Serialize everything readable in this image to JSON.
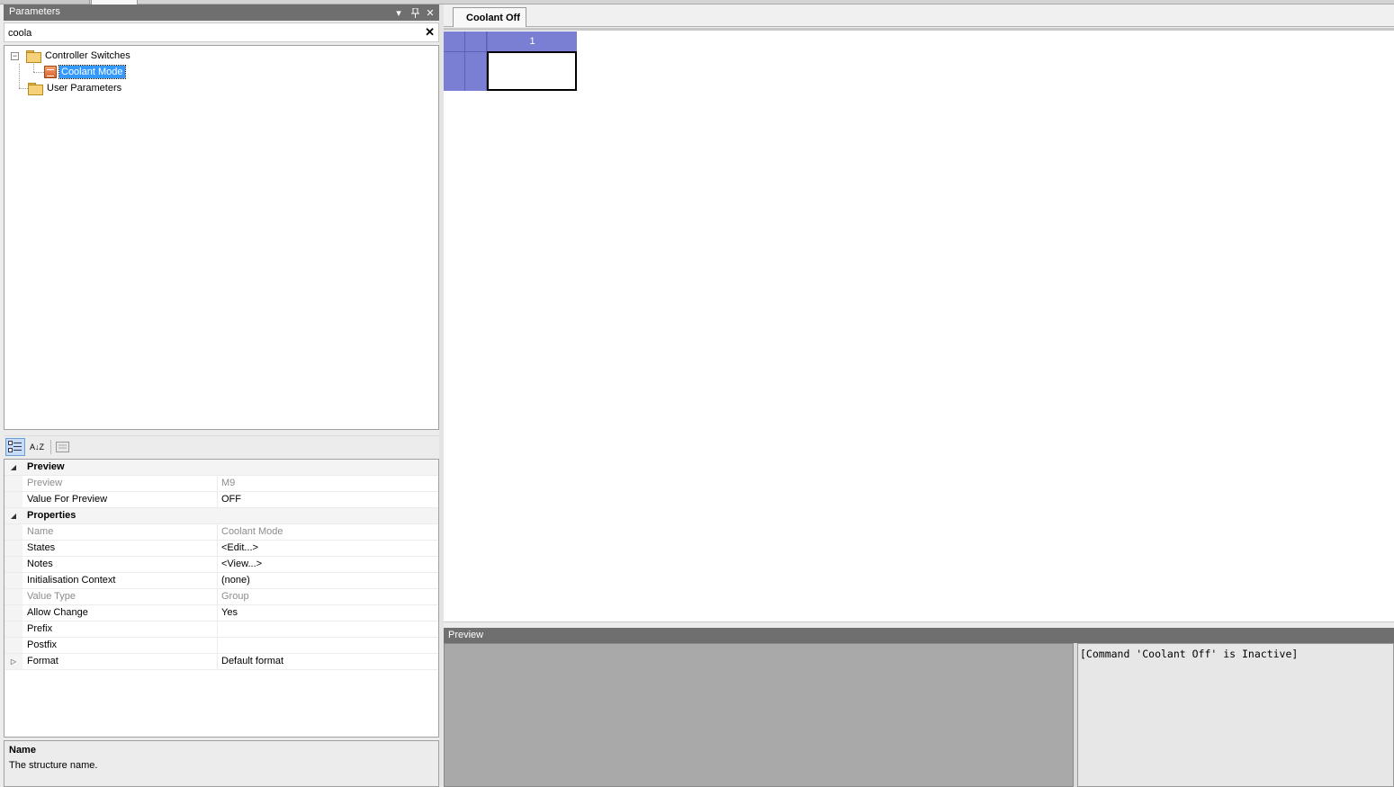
{
  "parameters_panel": {
    "title": "Parameters",
    "menu_glyph": "▾",
    "pin_glyph": "📌",
    "close_glyph": "✕"
  },
  "search": {
    "value": "coola",
    "clear_glyph": "✕"
  },
  "tree": {
    "nodes": [
      {
        "label": "Controller Switches",
        "type": "folder",
        "expanded": true,
        "expander": "−"
      },
      {
        "label": "Coolant Mode",
        "type": "parameter",
        "selected": true
      },
      {
        "label": "User Parameters",
        "type": "folder"
      }
    ]
  },
  "toolbar": {
    "categorized_icon": "categorized-icon",
    "alphabetical_glyph": "A↓Z",
    "pages_icon": "property-pages-icon"
  },
  "property_grid": {
    "categories": [
      {
        "name": "Preview",
        "expanded_glyph": "◢",
        "rows": [
          {
            "name": "Preview",
            "value": "M9",
            "disabled": true
          },
          {
            "name": "Value For Preview",
            "value": "OFF",
            "disabled": false
          }
        ]
      },
      {
        "name": "Properties",
        "expanded_glyph": "◢",
        "rows": [
          {
            "name": "Name",
            "value": "Coolant Mode",
            "disabled": true
          },
          {
            "name": "States",
            "value": "<Edit...>",
            "disabled": false
          },
          {
            "name": "Notes",
            "value": "<View...>",
            "disabled": false
          },
          {
            "name": "Initialisation Context",
            "value": "(none)",
            "disabled": false
          },
          {
            "name": "Value Type",
            "value": "Group",
            "disabled": true
          },
          {
            "name": "Allow Change",
            "value": "Yes",
            "disabled": false
          },
          {
            "name": "Prefix",
            "value": "",
            "disabled": false
          },
          {
            "name": "Postfix",
            "value": "",
            "disabled": false
          },
          {
            "name": "Format",
            "value": "Default format",
            "disabled": false,
            "collapsed_glyph": "▷"
          }
        ]
      }
    ]
  },
  "help": {
    "title": "Name",
    "description": "The structure name."
  },
  "document": {
    "tab_label": "Coolant Off",
    "column_header": "1"
  },
  "preview_panel": {
    "title": "Preview",
    "output": "[Command 'Coolant Off' is Inactive]"
  },
  "colors": {
    "header_bg": "#6f6f6f",
    "selection": "#3399ff",
    "grid_header": "#7b7fd4",
    "preview_left_bg": "#a9a9a9"
  }
}
